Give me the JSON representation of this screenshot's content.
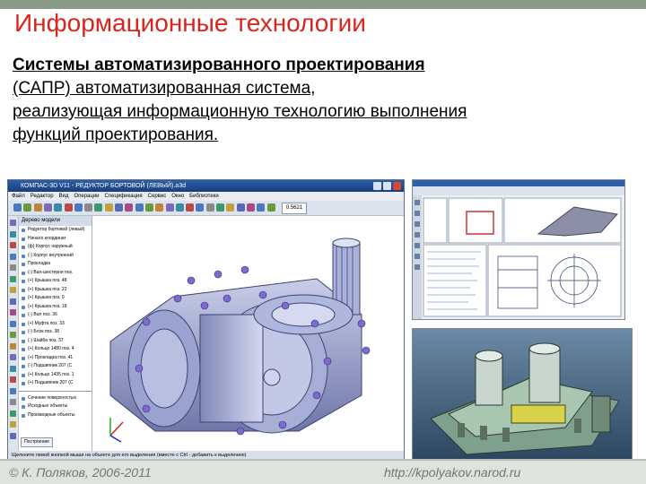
{
  "header": {
    "title": "Информационные технологии"
  },
  "content": {
    "term": "Системы автоматизированного проектирования",
    "def_line1": "(САПР)  автоматизированная система,",
    "def_line2": "реализующая информационную технологию выполнения",
    "def_line3": "функций проектирования."
  },
  "cad_window": {
    "title": "КОМПАС-3D V11 - РЕДУКТОР БОРТОВОЙ (ЛЕВЫЙ).a3d",
    "menu": [
      "Файл",
      "Редактор",
      "Вид",
      "Операции",
      "Спецификация",
      "Сервис",
      "Окно",
      "Библиотеки"
    ],
    "zoom_value": "0.5621",
    "doc_tab": "РЕДУКТОР БОРТОВОЙ (ЛЕВЫЙ).a3d",
    "tree_header": "Дерево модели",
    "tree_items": [
      "Редуктор бортовой (левый)",
      "Начало координат",
      "(ф) Корпус наружный",
      "(-) Корпус внутренний",
      "Прокладка",
      "(-) Вал-шестерня поз.",
      "(+) Крышка поз. 48",
      "(+) Крышка поз. 22",
      "(+) Крышка поз. 9",
      "(+) Крышка поз. 18",
      "(-) Вал поз. 36",
      "(+) Муфта поз. 33",
      "(-) Блок поз. 38",
      "(-) Шайба поз. 37",
      "(+) Кольцо 1480 поз. 4",
      "(+) Прокладка поз. 41",
      "(-) Подшипник 207 (С",
      "(+) Кольцо 1435 поз. 1",
      "(+) Подшипник 207 (С"
    ],
    "tree_bottom_items": [
      "Сечение поверхностью",
      "Исходные объекты",
      "Производные объекты"
    ],
    "construct_button": "Построение",
    "status_text": "Щелкните левой кнопкой мыши на объекте для его выделения (вместе с Ctrl - добавить к выделению)"
  },
  "footer": {
    "copyright": "© К. Поляков, 2006-2011",
    "url": "http://kpolyakov.narod.ru"
  },
  "colors": {
    "title_red": "#d8261e",
    "window_blue": "#2d5ea8",
    "model_blue": "#8c96c8"
  }
}
